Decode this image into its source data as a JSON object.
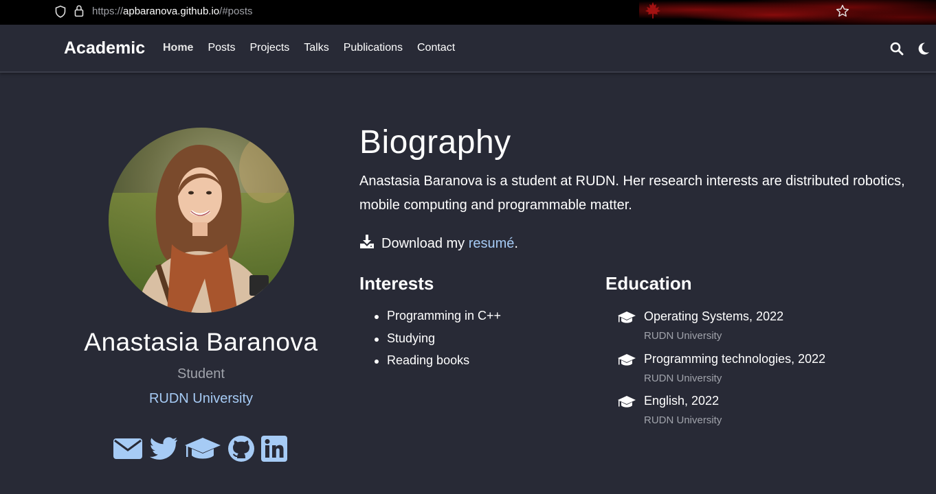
{
  "browser": {
    "url_scheme": "https://",
    "url_host": "apbaranova.github.io",
    "url_path": "/#posts"
  },
  "navbar": {
    "brand": "Academic",
    "items": [
      {
        "label": "Home",
        "active": true
      },
      {
        "label": "Posts"
      },
      {
        "label": "Projects"
      },
      {
        "label": "Talks"
      },
      {
        "label": "Publications"
      },
      {
        "label": "Contact"
      }
    ],
    "icons": [
      "search-icon",
      "moon-icon"
    ]
  },
  "profile": {
    "name": "Anastasia Baranova",
    "role": "Student",
    "organization": "RUDN University",
    "social_icons": [
      "envelope-icon",
      "twitter-icon",
      "graduation-cap-icon",
      "github-icon",
      "linkedin-icon"
    ]
  },
  "biography": {
    "title": "Biography",
    "text": "Anastasia Baranova is a student at RUDN. Her research interests are distributed robotics, mobile computing and programmable matter.",
    "download_prefix": "Download my ",
    "download_link": "resumé",
    "download_suffix": "."
  },
  "interests": {
    "title": "Interests",
    "items": [
      "Programming in C++",
      "Studying",
      "Reading books"
    ]
  },
  "education": {
    "title": "Education",
    "items": [
      {
        "course": "Operating Systems, 2022",
        "institution": "RUDN University"
      },
      {
        "course": "Programming technologies, 2022",
        "institution": "RUDN University"
      },
      {
        "course": "English, 2022",
        "institution": "RUDN University"
      }
    ]
  },
  "colors": {
    "background": "#282a36",
    "link": "#a6cbf5",
    "muted": "#a0a3ab"
  }
}
